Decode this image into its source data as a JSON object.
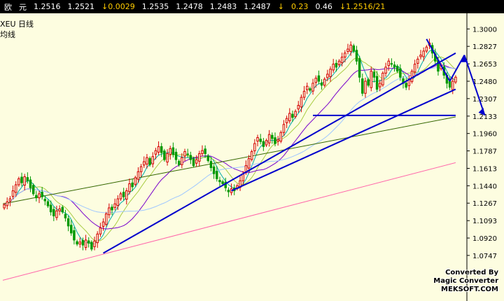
{
  "topbar": {
    "c1": "欧",
    "c2": "元",
    "v1": "1.2516",
    "v2": "1.2521",
    "v3": "↓0.0029",
    "v4": "1.2535",
    "v5": "1.2478",
    "v6": "1.2483",
    "v7": "1.2487",
    "v8": "↓",
    "v9": "0.23",
    "v10": "0.46",
    "v11": "↓1.2516/21"
  },
  "labels": {
    "symbol": "XEU  日线",
    "ma": "均线"
  },
  "watermark": {
    "line1": "Converted By",
    "line2": "Magic Converter",
    "line3": "MEKSOFT.COM"
  },
  "colors": {
    "background": "#fdfde0",
    "up_candle": "#d40000",
    "down_candle": "#009900",
    "trendline": "#0000cc",
    "ma5": "#00aaaa",
    "ma10": "#aacc44",
    "ma20": "#7700cc",
    "ma60": "#9fc7ff",
    "ma120": "#336600",
    "ma250": "#ff66aa"
  },
  "chart_data": {
    "type": "candlestick",
    "ylim": [
      1.06,
      1.31
    ],
    "y_ticks": [
      "1.3000",
      "1.2827",
      "1.2653",
      "1.2480",
      "1.2307",
      "1.2133",
      "1.1960",
      "1.1787",
      "1.1613",
      "1.1440",
      "1.1267",
      "1.1093",
      "1.0920",
      "1.0747"
    ],
    "closes": [
      1.125,
      1.128,
      1.131,
      1.139,
      1.145,
      1.151,
      1.147,
      1.153,
      1.149,
      1.142,
      1.136,
      1.132,
      1.136,
      1.133,
      1.129,
      1.124,
      1.118,
      1.114,
      1.119,
      1.121,
      1.118,
      1.112,
      1.104,
      1.097,
      1.09,
      1.086,
      1.088,
      1.085,
      1.09,
      1.087,
      1.081,
      1.089,
      1.096,
      1.102,
      1.108,
      1.116,
      1.122,
      1.12,
      1.126,
      1.131,
      1.136,
      1.133,
      1.139,
      1.146,
      1.143,
      1.152,
      1.158,
      1.163,
      1.168,
      1.172,
      1.165,
      1.173,
      1.179,
      1.183,
      1.177,
      1.17,
      1.176,
      1.181,
      1.175,
      1.17,
      1.165,
      1.172,
      1.178,
      1.175,
      1.17,
      1.164,
      1.17,
      1.176,
      1.179,
      1.176,
      1.169,
      1.162,
      1.156,
      1.151,
      1.148,
      1.146,
      1.142,
      1.138,
      1.141,
      1.139,
      1.144,
      1.149,
      1.156,
      1.164,
      1.171,
      1.178,
      1.186,
      1.192,
      1.188,
      1.183,
      1.189,
      1.195,
      1.191,
      1.186,
      1.19,
      1.197,
      1.205,
      1.211,
      1.216,
      1.212,
      1.218,
      1.224,
      1.232,
      1.238,
      1.243,
      1.239,
      1.246,
      1.251,
      1.248,
      1.244,
      1.25,
      1.255,
      1.26,
      1.265,
      1.262,
      1.268,
      1.272,
      1.276,
      1.28,
      1.284,
      1.278,
      1.268,
      1.252,
      1.236,
      1.248,
      1.244,
      1.258,
      1.252,
      1.24,
      1.246,
      1.256,
      1.262,
      1.268,
      1.265,
      1.262,
      1.258,
      1.252,
      1.246,
      1.242,
      1.25,
      1.258,
      1.265,
      1.27,
      1.274,
      1.278,
      1.282,
      1.286,
      1.276,
      1.268,
      1.258,
      1.264,
      1.254,
      1.246,
      1.242,
      1.248,
      1.252
    ],
    "ma_lines": [
      {
        "name": "MA250",
        "color": "#ff66aa",
        "from": [
          0,
          1.05
        ],
        "to": [
          155,
          1.167
        ]
      },
      {
        "name": "MA120",
        "color": "#336600",
        "from": [
          0,
          1.126
        ],
        "to": [
          155,
          1.2125
        ]
      }
    ],
    "trendlines": [
      {
        "from": [
          34,
          1.077
        ],
        "to": [
          155,
          1.276
        ]
      },
      {
        "from": [
          78,
          1.139
        ],
        "to": [
          155,
          1.24
        ]
      },
      {
        "from": [
          106,
          1.214
        ],
        "to": [
          155,
          1.214
        ]
      },
      {
        "from": [
          145,
          1.29
        ],
        "to": [
          153,
          1.248
        ]
      },
      {
        "from": [
          153,
          1.248
        ],
        "to": [
          158,
          1.274
        ]
      },
      {
        "from": [
          158,
          1.274
        ],
        "to": [
          165,
          1.214
        ]
      }
    ]
  }
}
